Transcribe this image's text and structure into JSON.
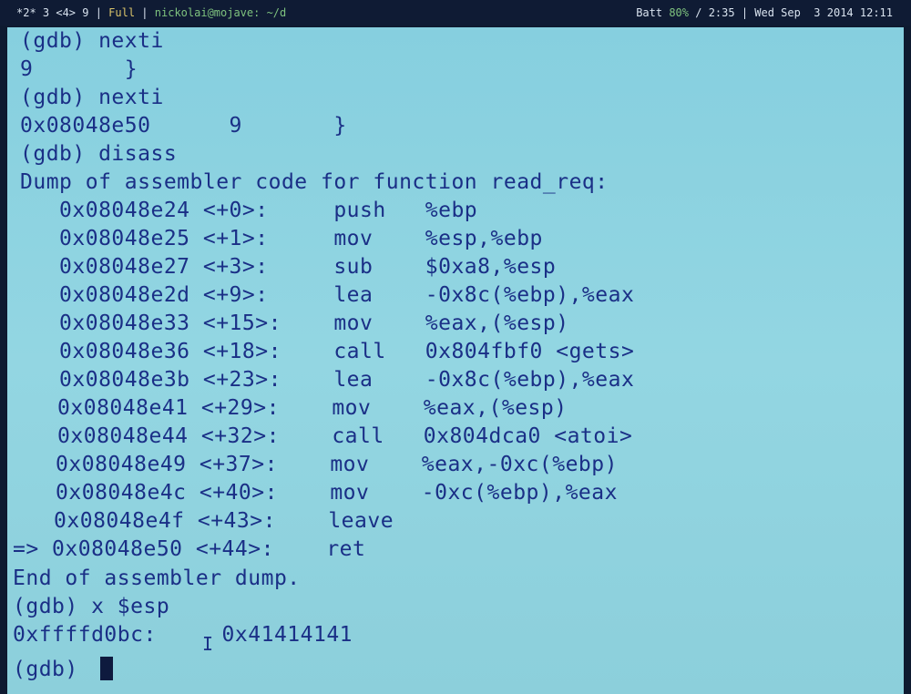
{
  "statusbar": {
    "windows": "*2* 3 <4> 9 |",
    "mode": "Full",
    "sep1": "|",
    "host": "nickolai@mojave: ~/d",
    "batt_label": "Batt",
    "batt_pct": "80%",
    "batt_rest": "/ 2:35 | Wed Sep  3 2014 12:11"
  },
  "terminal": {
    "lines": [
      "(gdb) nexti",
      "9       }",
      "(gdb) nexti",
      "0x08048e50      9       }",
      "(gdb) disass",
      "Dump of assembler code for function read_req:",
      "   0x08048e24 <+0>:     push   %ebp",
      "   0x08048e25 <+1>:     mov    %esp,%ebp",
      "   0x08048e27 <+3>:     sub    $0xa8,%esp",
      "   0x08048e2d <+9>:     lea    -0x8c(%ebp),%eax",
      "   0x08048e33 <+15>:    mov    %eax,(%esp)",
      "   0x08048e36 <+18>:    call   0x804fbf0 <gets>",
      "   0x08048e3b <+23>:    lea    -0x8c(%ebp),%eax",
      "   0x08048e41 <+29>:    mov    %eax,(%esp)",
      "   0x08048e44 <+32>:    call   0x804dca0 <atoi>",
      "   0x08048e49 <+37>:    mov    %eax,-0xc(%ebp)",
      "   0x08048e4c <+40>:    mov    -0xc(%ebp),%eax",
      "   0x08048e4f <+43>:    leave",
      "=> 0x08048e50 <+44>:    ret",
      "End of assembler dump.",
      "(gdb) x $esp",
      "0xffffd0bc:     0x41414141",
      "(gdb) "
    ]
  }
}
